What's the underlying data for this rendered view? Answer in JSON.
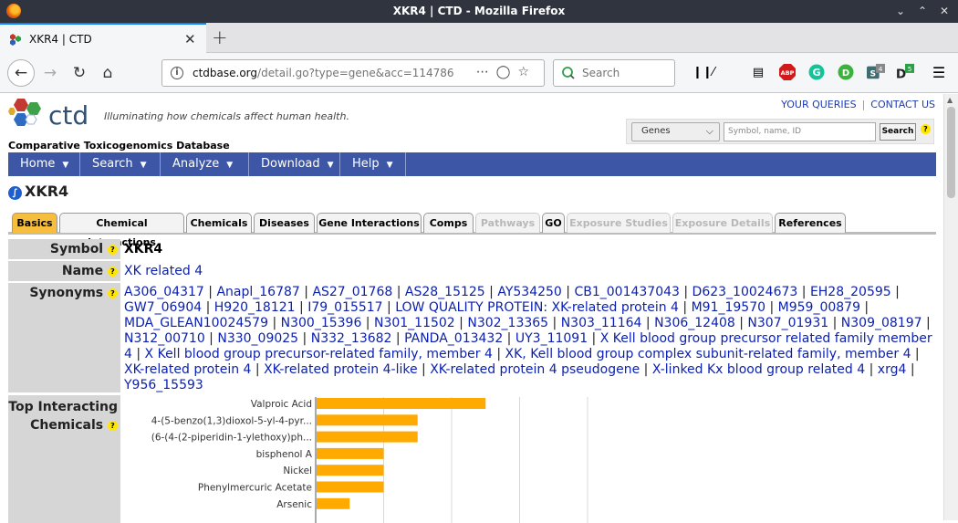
{
  "window": {
    "title": "XKR4 | CTD - Mozilla Firefox"
  },
  "browser": {
    "tab_title": "XKR4 | CTD",
    "url_host": "ctdbase.org",
    "url_path": "/detail.go?type=gene&acc=114786",
    "search_placeholder": "Search",
    "badge_count_1": "4",
    "badge_count_2": "5",
    "abp_label": "ABP"
  },
  "site": {
    "logo_text": "ctd",
    "tagline": "Illuminating how chemicals affect human health.",
    "db_name": "Comparative Toxicogenomics Database",
    "top_links": [
      "YOUR QUERIES",
      "CONTACT US"
    ],
    "search": {
      "select_value": "Genes",
      "input_placeholder": "Symbol, name, ID",
      "button_label": "Search"
    },
    "nav": [
      "Home",
      "Search",
      "Analyze",
      "Download",
      "Help"
    ]
  },
  "gene": {
    "title": "XKR4",
    "tabs": [
      {
        "label": "Basics",
        "state": "active"
      },
      {
        "label": "Chemical Interactions",
        "state": "normal"
      },
      {
        "label": "Chemicals",
        "state": "normal"
      },
      {
        "label": "Diseases",
        "state": "normal"
      },
      {
        "label": "Gene Interactions",
        "state": "normal"
      },
      {
        "label": "Comps",
        "state": "normal"
      },
      {
        "label": "Pathways",
        "state": "disabled"
      },
      {
        "label": "GO",
        "state": "normal"
      },
      {
        "label": "Exposure Studies",
        "state": "disabled"
      },
      {
        "label": "Exposure Details",
        "state": "disabled"
      },
      {
        "label": "References",
        "state": "normal"
      }
    ],
    "fields": {
      "symbol_label": "Symbol",
      "symbol_value": "XKR4",
      "name_label": "Name",
      "name_value": "XK related 4",
      "synonyms_label": "Synonyms",
      "synonyms": [
        "A306_04317",
        "Anapl_16787",
        "AS27_01768",
        "AS28_15125",
        "AY534250",
        "CB1_001437043",
        "D623_10024673",
        "EH28_20595",
        "GW7_06904",
        "H920_18121",
        "I79_015517",
        "LOW QUALITY PROTEIN: XK-related protein 4",
        "M91_19570",
        "M959_00879",
        "MDA_GLEAN10024579",
        "N300_15396",
        "N301_11502",
        "N302_13365",
        "N303_11164",
        "N306_12408",
        "N307_01931",
        "N309_08197",
        "N312_00710",
        "N330_09025",
        "N332_13682",
        "PANDA_013432",
        "UY3_11091",
        "X Kell blood group precursor related family member 4",
        "X Kell blood group precursor-related family, member 4",
        "XK, Kell blood group complex subunit-related family, member 4",
        "XK-related protein 4",
        "XK-related protein 4-like",
        "XK-related protein 4 pseudogene",
        "X-linked Kx blood group related 4",
        "xrg4",
        "Y956_15593"
      ],
      "chem_label_line1": "Top Interacting",
      "chem_label_line2": "Chemicals"
    }
  },
  "chart_data": {
    "type": "bar",
    "orientation": "horizontal",
    "categories": [
      "Valproic Acid",
      "4-(5-benzo(1,3)dioxol-5-yl-4-pyr...",
      "(6-(4-(2-piperidin-1-ylethoxy)ph...",
      "bisphenol A",
      "Nickel",
      "Phenylmercuric Acetate",
      "Arsenic"
    ],
    "values": [
      5,
      3,
      3,
      2,
      2,
      2,
      1
    ],
    "xlim": [
      0,
      8
    ],
    "grid": true,
    "bar_color": "#ffaa00"
  }
}
